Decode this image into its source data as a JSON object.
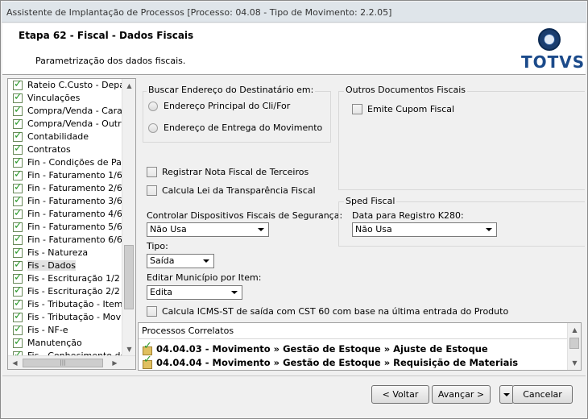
{
  "window": {
    "title": "Assistente de Implantação de Processos [Processo: 04.08 - Tipo de Movimento: 2.2.05]"
  },
  "header": {
    "title": "Etapa 62 - Fiscal - Dados Fiscais",
    "subtitle": "Parametrização dos dados fiscais.",
    "logo_text": "TOTVS",
    "brand_color": "#1b4a8a"
  },
  "tree": {
    "items": [
      {
        "label": "Rateio C.Custo - Depart"
      },
      {
        "label": "Vinculações"
      },
      {
        "label": "Compra/Venda - Caracte"
      },
      {
        "label": "Compra/Venda - Outros"
      },
      {
        "label": "Contabilidade"
      },
      {
        "label": "Contratos"
      },
      {
        "label": "Fin - Condições de Paga"
      },
      {
        "label": "Fin - Faturamento 1/6"
      },
      {
        "label": "Fin - Faturamento 2/6"
      },
      {
        "label": "Fin - Faturamento 3/6"
      },
      {
        "label": "Fin - Faturamento 4/6"
      },
      {
        "label": "Fin - Faturamento 5/6"
      },
      {
        "label": "Fin - Faturamento 6/6"
      },
      {
        "label": "Fis - Natureza"
      },
      {
        "label": "Fis - Dados",
        "selected": true
      },
      {
        "label": "Fis - Escrituração 1/2"
      },
      {
        "label": "Fis - Escrituração 2/2"
      },
      {
        "label": "Fis - Tributação - Item"
      },
      {
        "label": "Fis - Tributação - Movim"
      },
      {
        "label": "Fis - NF-e"
      },
      {
        "label": "Manutenção"
      },
      {
        "label": "Fis - Conhecimento de T"
      }
    ]
  },
  "buscar": {
    "title": "Buscar Endereço do Destinatário em:",
    "option1": "Endereço Principal do Cli/For",
    "option2": "Endereço de Entrega do Movimento"
  },
  "outros": {
    "title": "Outros Documentos Fiscais",
    "emite_cupom": "Emite Cupom Fiscal"
  },
  "checks": {
    "registrar_nota": "Registrar Nota Fiscal de Terceiros",
    "calcula_lei": "Calcula Lei da Transparência Fiscal",
    "calcula_icms": "Calcula ICMS-ST de saída com CST 60 com base na última entrada do Produto"
  },
  "fields": {
    "controlar_label": "Controlar Dispositivos Fiscais de Segurança:",
    "controlar_value": "Não Usa",
    "tipo_label": "Tipo:",
    "tipo_value": "Saída",
    "editar_label": "Editar Município por Item:",
    "editar_value": "Edita"
  },
  "sped": {
    "title": "Sped Fiscal",
    "data_label": "Data para Registro K280:",
    "data_value": "Não Usa"
  },
  "processos": {
    "title": "Processos Correlatos",
    "rows": [
      "04.04.03 - Movimento » Gestão de Estoque » Ajuste de Estoque",
      "04.04.04 - Movimento » Gestão de Estoque » Requisição de Materiais"
    ]
  },
  "buttons": {
    "voltar": "< Voltar",
    "avancar": "Avançar >",
    "cancelar": "Cancelar"
  }
}
